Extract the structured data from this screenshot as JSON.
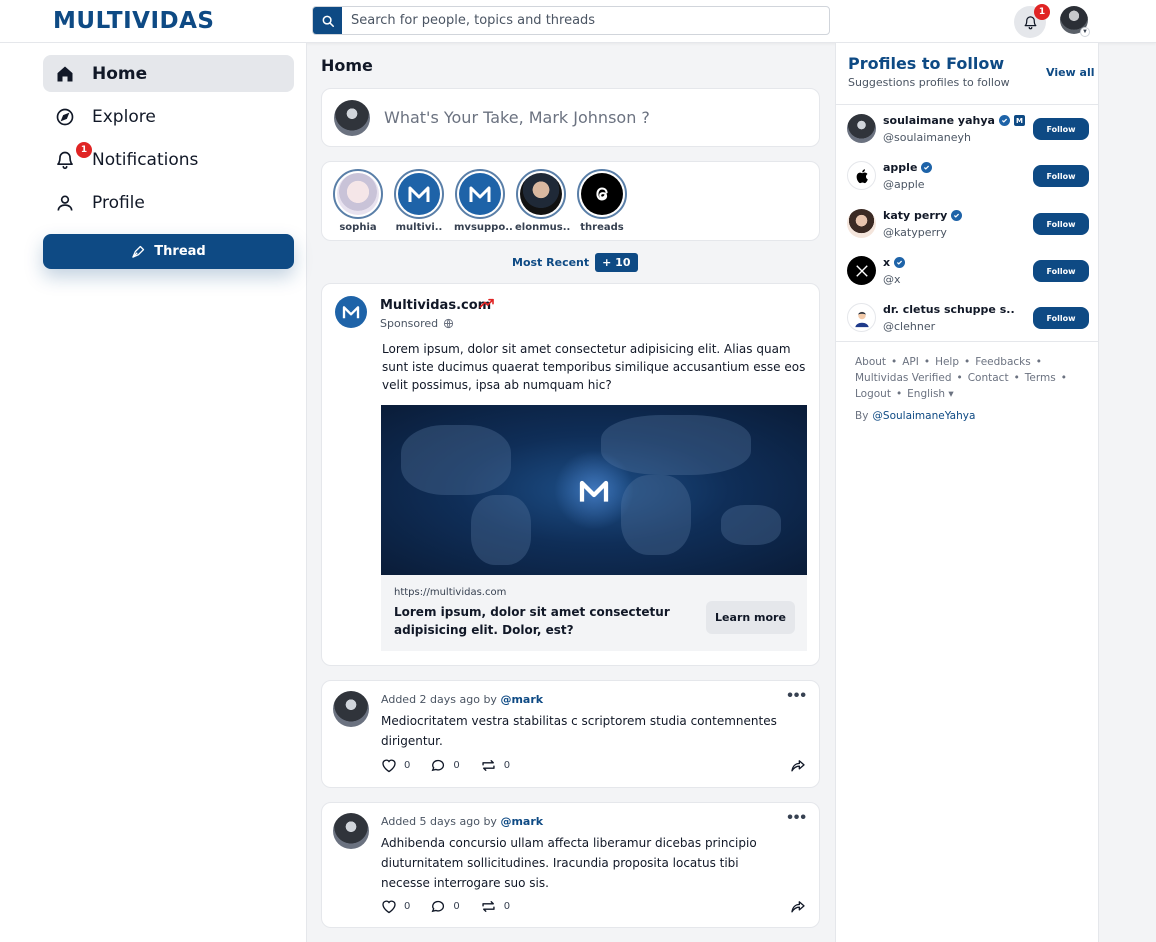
{
  "header": {
    "logo": "MULTIVIDAS",
    "search_placeholder": "Search for people, topics and threads",
    "notif_count": "1"
  },
  "nav": {
    "items": [
      {
        "label": "Home",
        "icon": "home-icon",
        "active": true
      },
      {
        "label": "Explore",
        "icon": "compass-icon"
      },
      {
        "label": "Notifications",
        "icon": "bell-icon",
        "badge": "1"
      },
      {
        "label": "Profile",
        "icon": "user-icon"
      }
    ],
    "thread_button": "Thread"
  },
  "feed": {
    "title": "Home",
    "compose_placeholder": "What's Your Take, Mark Johnson ?",
    "stories": [
      {
        "label": "sophia"
      },
      {
        "label": "multivi.."
      },
      {
        "label": "mvsuppo.."
      },
      {
        "label": "elonmus.."
      },
      {
        "label": "threads"
      }
    ],
    "most_recent_label": "Most Recent",
    "most_recent_count": "+ 10",
    "sponsored": {
      "name": "Multividas.com",
      "tag": "Sponsored",
      "body": "Lorem ipsum, dolor sit amet consectetur adipisicing elit. Alias quam sunt iste ducimus quaerat temporibus similique accusantium esse eos velit possimus, ipsa ab numquam hic?",
      "url": "https://multividas.com",
      "headline": "Lorem ipsum, dolor sit amet consectetur adipisicing elit. Dolor, est?",
      "cta": "Learn more"
    },
    "posts": [
      {
        "added": "Added 2 days ago by",
        "user": "@mark",
        "text": "Mediocritatem vestra stabilitas c scriptorem studia contemnentes dirigentur.",
        "likes": "0",
        "comments": "0",
        "reposts": "0"
      },
      {
        "added": "Added 5 days ago by",
        "user": "@mark",
        "text": "Adhibenda concursio ullam affecta liberamur dicebas principio diuturnitatem sollicitudines. Iracundia proposita locatus tibi necesse interrogare suo sis.",
        "likes": "0",
        "comments": "0",
        "reposts": "0"
      }
    ]
  },
  "right": {
    "title": "Profiles to Follow",
    "subtitle": "Suggestions profiles to follow",
    "view_all": "View all",
    "follow_label": "Follow",
    "profiles": [
      {
        "name": "soulaimane yahya",
        "handle": "@soulaimaneyh"
      },
      {
        "name": "apple",
        "handle": "@apple"
      },
      {
        "name": "katy perry",
        "handle": "@katyperry"
      },
      {
        "name": "x",
        "handle": "@x"
      },
      {
        "name": "dr. cletus schuppe s..",
        "handle": "@clehner"
      }
    ],
    "footer": {
      "links": [
        "About",
        "API",
        "Help",
        "Feedbacks",
        "Multividas Verified",
        "Contact",
        "Terms",
        "Logout"
      ],
      "language": "English",
      "by_label": "By",
      "by_handle": "@SoulaimaneYahya"
    }
  },
  "colors": {
    "brand": "#0e4a84",
    "badge": "#e02424",
    "background": "#f3f4f6"
  }
}
